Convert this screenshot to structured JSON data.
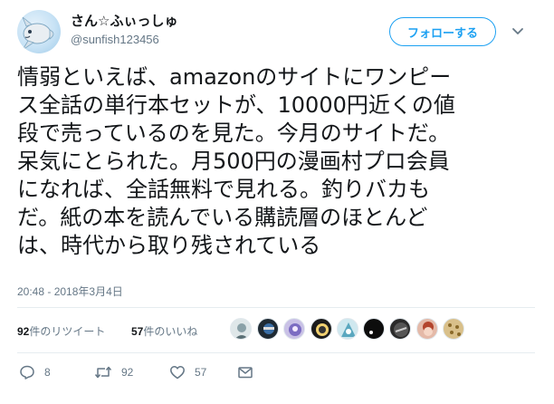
{
  "user": {
    "display_name": "さん☆ふぃっしゅ",
    "handle": "@sunfish123456",
    "avatar_icon": "sunfish-avatar-icon"
  },
  "header": {
    "follow_label": "フォローする",
    "caret_icon": "chevron-down-icon"
  },
  "tweet": {
    "lines": [
      "情弱といえば、amazonのサイトにワンピー",
      "ス全話の単行本セットが、10000円近くの値",
      "段で売っているのを見た。今月のサイトだ。",
      "呆気にとられた。月500円の漫画村プロ会員",
      "になれば、全話無料で見れる。釣りバカも",
      "だ。紙の本を読んでいる購読層のほとんど",
      "は、時代から取り残されている"
    ],
    "timestamp": "20:48 - 2018年3月4日"
  },
  "stats": {
    "retweets_count": "92",
    "retweets_label": "件のリツイート",
    "likes_count": "57",
    "likes_label": "件のいいね"
  },
  "actions": {
    "reply_count": "8",
    "retweet_count": "92",
    "like_count": "57"
  },
  "colors": {
    "accent": "#1da1f2",
    "muted": "#657786",
    "text": "#14171a",
    "divider": "#e6ecf0"
  }
}
